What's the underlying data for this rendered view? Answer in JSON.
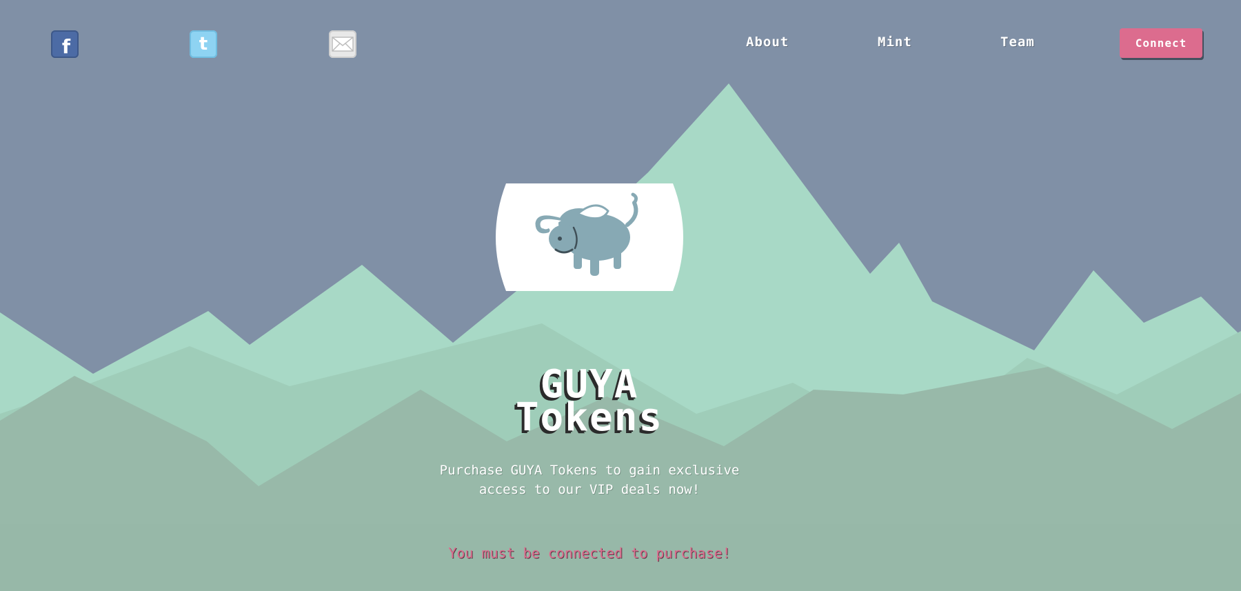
{
  "nav": {
    "social": [
      {
        "name": "facebook",
        "icon": "facebook-icon"
      },
      {
        "name": "twitter",
        "icon": "twitter-icon"
      },
      {
        "name": "email",
        "icon": "mail-icon"
      }
    ],
    "links": {
      "about": "About",
      "mint": "Mint",
      "team": "Team"
    },
    "connect_label": "Connect"
  },
  "hero": {
    "logo_icon": "buffalo-icon",
    "title_line1": "GUYA",
    "title_line2": "Tokens",
    "subtitle_line1": "Purchase GUYA Tokens to gain exclusive",
    "subtitle_line2": "access to our VIP deals now!",
    "warning": "You must be connected to purchase!"
  },
  "colors": {
    "sky": "#8090a6",
    "mountain_light": "#a7d8c5",
    "mountain_mid": "#9dc7b5",
    "mountain_dark": "#97b7a7",
    "accent": "#dc6c8e"
  }
}
